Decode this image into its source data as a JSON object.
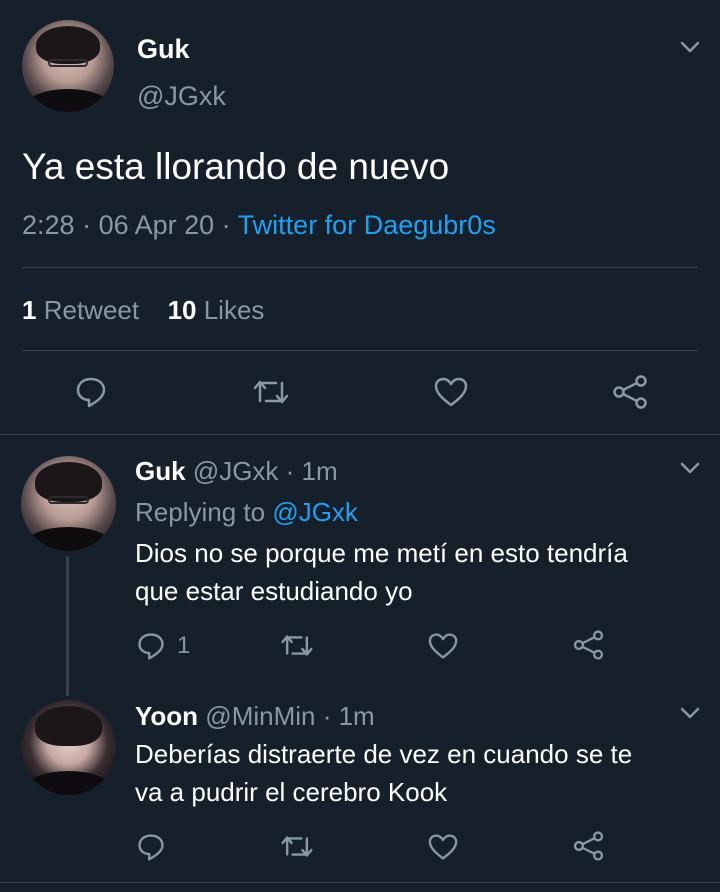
{
  "main_tweet": {
    "name": "Guk",
    "handle": "@JGxk",
    "text": "Ya esta llorando de nuevo",
    "time": "2:28",
    "sep1": " · ",
    "date": "06 Apr 20",
    "sep2": " · ",
    "source": "Twitter for Daegubr0s",
    "retweets_count": "1",
    "retweets_label": "Retweet",
    "likes_count": "10",
    "likes_label": "Likes"
  },
  "replies": [
    {
      "name": "Guk",
      "handle": "@JGxk",
      "time": "· 1m",
      "replying_label": "Replying to",
      "replying_to": "@JGxk",
      "text_line1": "Dios no se porque me metí en esto tendría",
      "text_line2": "que estar estudiando yo",
      "reply_count": "1"
    },
    {
      "name": "Yoon",
      "handle": "@MinMin",
      "time": "· 1m",
      "text_line1": "Deberías distraerte de vez en cuando se te",
      "text_line2": "va a pudrir el cerebro Kook"
    }
  ],
  "icons": [
    "chevron-down-icon",
    "reply-icon",
    "retweet-icon",
    "like-icon",
    "share-icon"
  ],
  "colors": {
    "background": "#15202b",
    "text": "#ffffff",
    "muted": "#8899a6",
    "accent": "#1da1f2",
    "divider": "#38444d"
  }
}
